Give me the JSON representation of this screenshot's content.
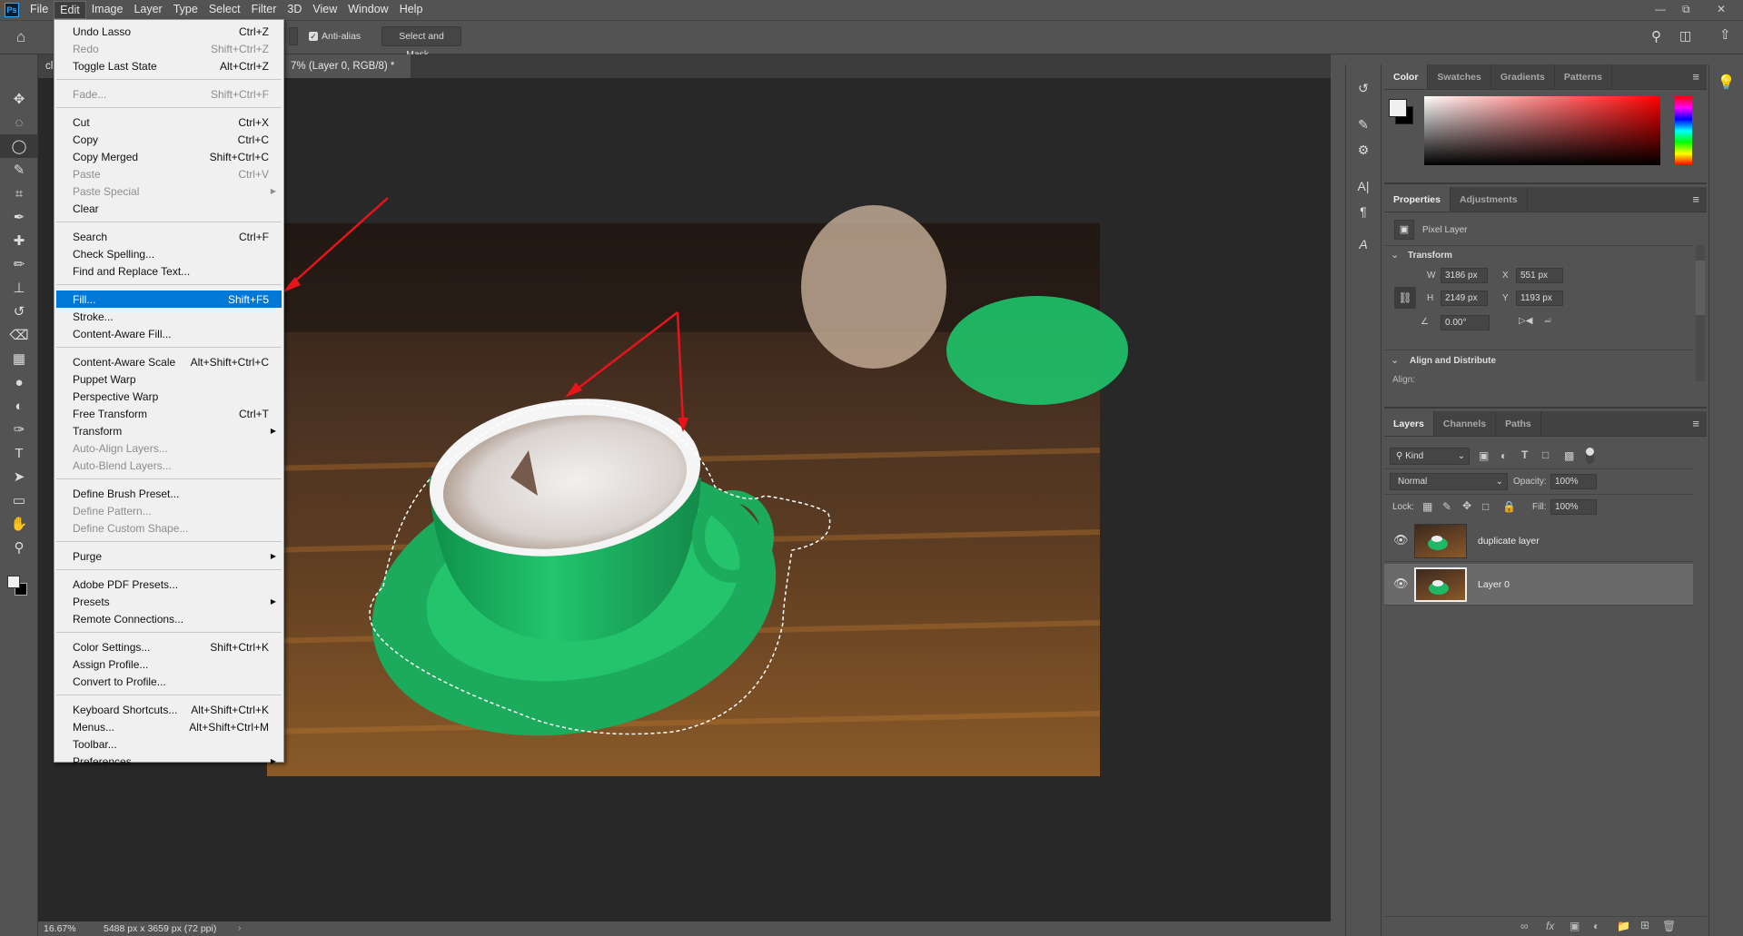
{
  "app": {
    "logo": "Ps",
    "menus": [
      "File",
      "Edit",
      "Image",
      "Layer",
      "Type",
      "Select",
      "Filter",
      "3D",
      "View",
      "Window",
      "Help"
    ],
    "active_menu": "Edit"
  },
  "options": {
    "anti_alias_label": "Anti-alias",
    "anti_alias_checked": true,
    "select_mask_label": "Select and Mask..."
  },
  "tabs": [
    {
      "label": "cl"
    },
    {
      "label": "7% (Layer 0, RGB/8) *"
    }
  ],
  "status": {
    "zoom": "16.67%",
    "doc_info": "5488 px x 3659 px (72 ppi)"
  },
  "edit_menu": [
    {
      "label": "Undo Lasso",
      "shortcut": "Ctrl+Z"
    },
    {
      "label": "Redo",
      "shortcut": "Shift+Ctrl+Z",
      "disabled": true
    },
    {
      "label": "Toggle Last State",
      "shortcut": "Alt+Ctrl+Z"
    },
    {
      "sep": true
    },
    {
      "label": "Fade...",
      "shortcut": "Shift+Ctrl+F",
      "disabled": true
    },
    {
      "sep": true
    },
    {
      "label": "Cut",
      "shortcut": "Ctrl+X"
    },
    {
      "label": "Copy",
      "shortcut": "Ctrl+C"
    },
    {
      "label": "Copy Merged",
      "shortcut": "Shift+Ctrl+C"
    },
    {
      "label": "Paste",
      "shortcut": "Ctrl+V",
      "disabled": true
    },
    {
      "label": "Paste Special",
      "submenu": true,
      "disabled": true
    },
    {
      "label": "Clear"
    },
    {
      "sep": true
    },
    {
      "label": "Search",
      "shortcut": "Ctrl+F"
    },
    {
      "label": "Check Spelling..."
    },
    {
      "label": "Find and Replace Text..."
    },
    {
      "sep": true
    },
    {
      "label": "Fill...",
      "shortcut": "Shift+F5",
      "highlighted": true
    },
    {
      "label": "Stroke..."
    },
    {
      "label": "Content-Aware Fill..."
    },
    {
      "sep": true
    },
    {
      "label": "Content-Aware Scale",
      "shortcut": "Alt+Shift+Ctrl+C"
    },
    {
      "label": "Puppet Warp"
    },
    {
      "label": "Perspective Warp"
    },
    {
      "label": "Free Transform",
      "shortcut": "Ctrl+T"
    },
    {
      "label": "Transform",
      "submenu": true
    },
    {
      "label": "Auto-Align Layers...",
      "disabled": true
    },
    {
      "label": "Auto-Blend Layers...",
      "disabled": true
    },
    {
      "sep": true
    },
    {
      "label": "Define Brush Preset..."
    },
    {
      "label": "Define Pattern...",
      "disabled": true
    },
    {
      "label": "Define Custom Shape...",
      "disabled": true
    },
    {
      "sep": true
    },
    {
      "label": "Purge",
      "submenu": true
    },
    {
      "sep": true
    },
    {
      "label": "Adobe PDF Presets..."
    },
    {
      "label": "Presets",
      "submenu": true
    },
    {
      "label": "Remote Connections..."
    },
    {
      "sep": true
    },
    {
      "label": "Color Settings...",
      "shortcut": "Shift+Ctrl+K"
    },
    {
      "label": "Assign Profile..."
    },
    {
      "label": "Convert to Profile..."
    },
    {
      "sep": true
    },
    {
      "label": "Keyboard Shortcuts...",
      "shortcut": "Alt+Shift+Ctrl+K"
    },
    {
      "label": "Menus...",
      "shortcut": "Alt+Shift+Ctrl+M"
    },
    {
      "label": "Toolbar..."
    },
    {
      "label": "Preferences",
      "submenu": true
    }
  ],
  "color_panel": {
    "tabs": [
      "Color",
      "Swatches",
      "Gradients",
      "Patterns"
    ],
    "foreground": "#f0f0f0",
    "background": "#000000",
    "hue": "#ff0000"
  },
  "properties": {
    "tabs": [
      "Properties",
      "Adjustments"
    ],
    "layer_type": "Pixel Layer",
    "transform_title": "Transform",
    "w_label": "W",
    "w": "3186 px",
    "h_label": "H",
    "h": "2149 px",
    "x_label": "X",
    "x": "551 px",
    "y_label": "Y",
    "y": "1193 px",
    "angle": "0.00°",
    "align_title": "Align and Distribute",
    "align_label": "Align:"
  },
  "layers_panel": {
    "tabs": [
      "Layers",
      "Channels",
      "Paths"
    ],
    "filter": "Kind",
    "blend_mode": "Normal",
    "opacity_label": "Opacity:",
    "opacity": "100%",
    "lock_label": "Lock:",
    "fill_label": "Fill:",
    "fill": "100%",
    "layers": [
      {
        "name": "duplicate layer",
        "visible": true,
        "selected": false
      },
      {
        "name": "Layer 0",
        "visible": true,
        "selected": true
      }
    ]
  },
  "colors": {
    "accent": "#0078d7",
    "annotation_arrow": "#e8141b",
    "cup_green": "#1fb865"
  }
}
